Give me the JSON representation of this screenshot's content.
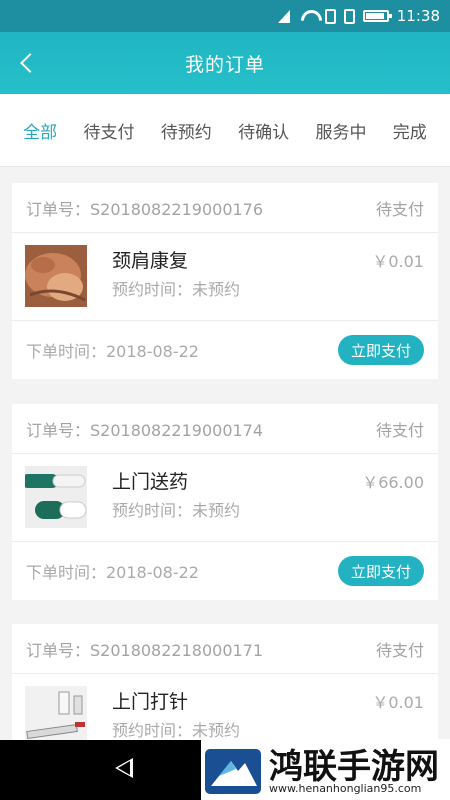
{
  "status_bar": {
    "time": "11:38"
  },
  "header": {
    "title": "我的订单"
  },
  "tabs": [
    {
      "label": "全部",
      "active": true
    },
    {
      "label": "待支付"
    },
    {
      "label": "待预约"
    },
    {
      "label": "待确认"
    },
    {
      "label": "服务中"
    },
    {
      "label": "完成"
    }
  ],
  "orders": [
    {
      "order_label": "订单号：S2018082219000176",
      "status": "待支付",
      "service": "颈肩康复",
      "appointment": "预约时间：未预约",
      "price": "￥0.01",
      "created": "下单时间：2018-08-22",
      "button": "立即支付",
      "thumbnail": "massage-photo"
    },
    {
      "order_label": "订单号：S2018082219000174",
      "status": "待支付",
      "service": "上门送药",
      "appointment": "预约时间：未预约",
      "price": "￥66.00",
      "created": "下单时间：2018-08-22",
      "button": "立即支付",
      "thumbnail": "capsules-photo"
    },
    {
      "order_label": "订单号：S2018082218000171",
      "status": "待支付",
      "service": "上门打针",
      "appointment": "预约时间：未预约",
      "price": "￥0.01",
      "thumbnail": "syringe-photo"
    }
  ],
  "watermark": {
    "title": "鸿联手游网",
    "url": "www.henanhonglian95.com"
  },
  "colors": {
    "accent": "#25bfc9",
    "status_bar": "#1e8fa1",
    "button": "#23b2c2"
  }
}
